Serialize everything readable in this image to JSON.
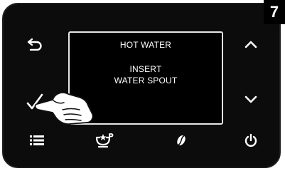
{
  "step_number": "7",
  "display": {
    "title": "HOT WATER",
    "message_line1": "INSERT",
    "message_line2": "WATER SPOUT"
  },
  "buttons": {
    "back": "back-icon",
    "up": "chevron-up-icon",
    "down": "chevron-down-icon",
    "confirm": "checkmark-icon",
    "menu": "menu-list-icon",
    "favorites": "favorite-beverage-icon",
    "coffee": "coffee-bean-icon",
    "power": "power-icon"
  },
  "colors": {
    "panel": "#0c0c0c",
    "icon": "#ffffff",
    "display_border": "#e6e6e6"
  }
}
